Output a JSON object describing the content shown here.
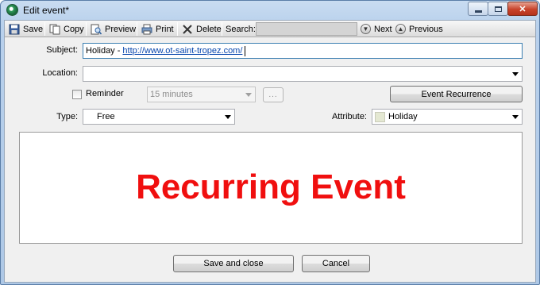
{
  "window": {
    "title": "Edit event*"
  },
  "toolbar": {
    "save": "Save",
    "copy": "Copy",
    "preview": "Preview",
    "print": "Print",
    "delete": "Delete",
    "search_label": "Search:",
    "search_value": "",
    "next": "Next",
    "previous": "Previous"
  },
  "form": {
    "subject_label": "Subject:",
    "subject_text": "Holiday -",
    "subject_link": "http://www.ot-saint-tropez.com/",
    "location_label": "Location:",
    "location_value": "",
    "reminder_label": "Reminder",
    "reminder_checked": false,
    "reminder_value": "15 minutes",
    "dots_label": "...",
    "recurrence_button": "Event Recurrence",
    "type_label": "Type:",
    "type_value": "Free",
    "attribute_label": "Attribute:",
    "attribute_value": "Holiday",
    "attribute_color": "#e4e8d2"
  },
  "body": {
    "text": "Recurring Event",
    "color": "#f00f0f"
  },
  "footer": {
    "save_close": "Save and close",
    "cancel": "Cancel"
  }
}
